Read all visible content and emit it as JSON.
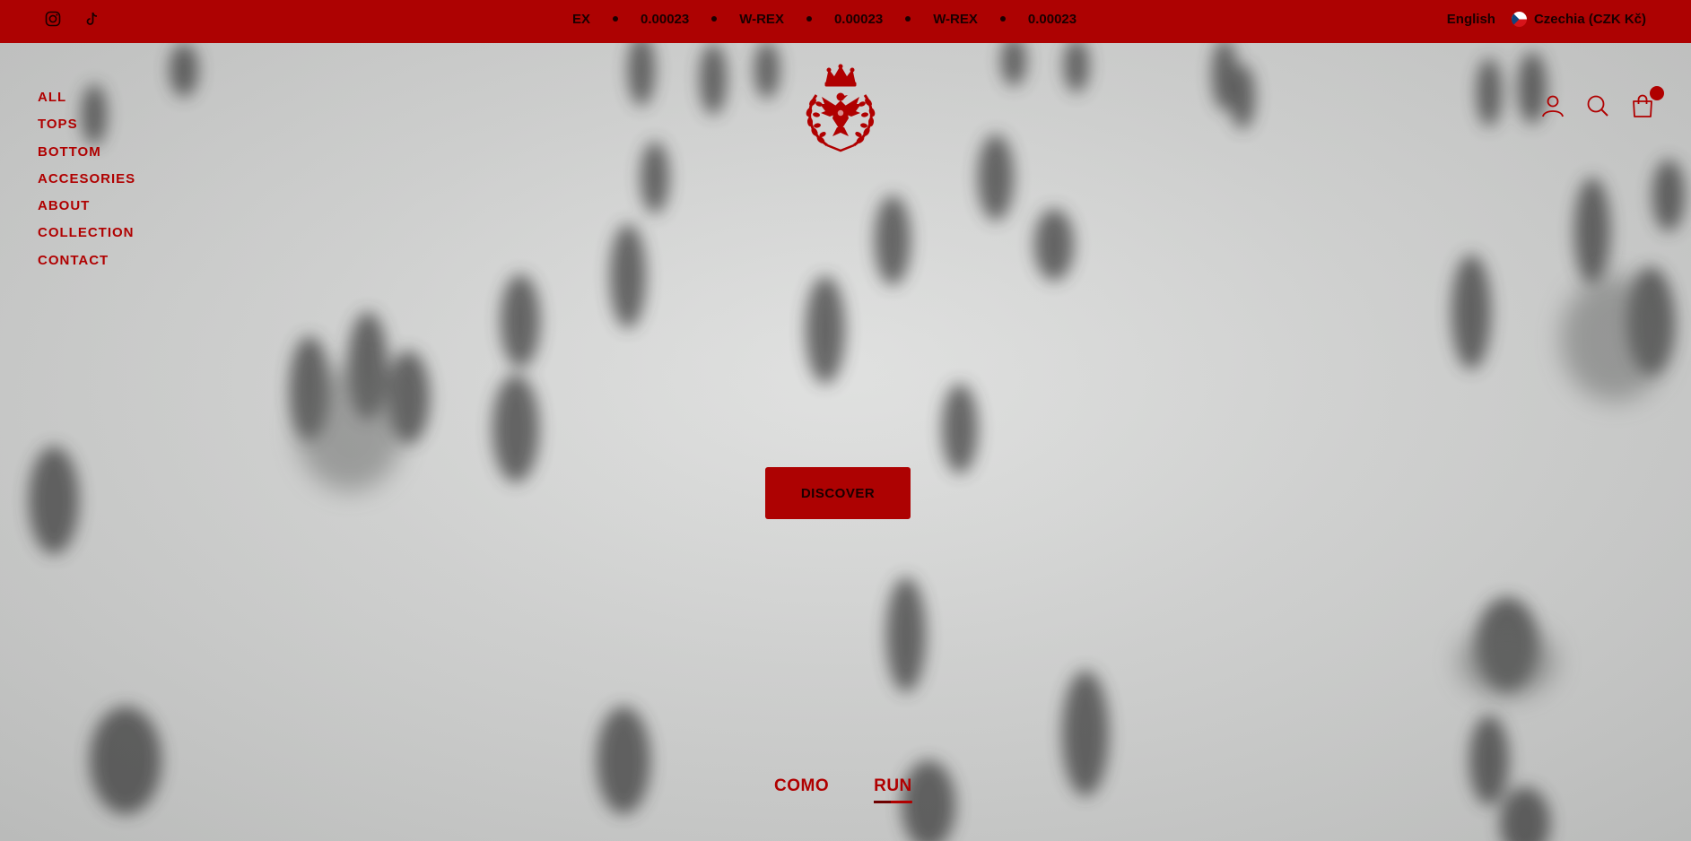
{
  "social": {
    "instagram_icon": "instagram-icon",
    "tiktok_icon": "tiktok-icon"
  },
  "marquee": {
    "items": [
      "EX",
      "0.00023",
      "W-REX",
      "0.00023",
      "W-REX",
      "0.00023"
    ]
  },
  "locale": {
    "language": "English",
    "country": "Czechia (CZK Kč)",
    "flag_icon": "czech-flag-icon"
  },
  "nav": {
    "items": [
      "ALL",
      "TOPS",
      "BOTTOM",
      "ACCESORIES",
      "ABOUT",
      "COLLECTION",
      "CONTACT"
    ]
  },
  "logo": {
    "icon": "crown-eagle-wreath-crest"
  },
  "header_icons": [
    "account-icon",
    "search-icon",
    "cart-icon"
  ],
  "hero": {
    "cta_label": "DISCOVER",
    "slides": [
      "COMO",
      "RUN"
    ],
    "active_slide": "RUN"
  },
  "colors": {
    "brand_red": "#ad0202",
    "nav_red": "#b00000",
    "dark_text": "#1a0000",
    "hero_bg": "#cfd0cf"
  }
}
